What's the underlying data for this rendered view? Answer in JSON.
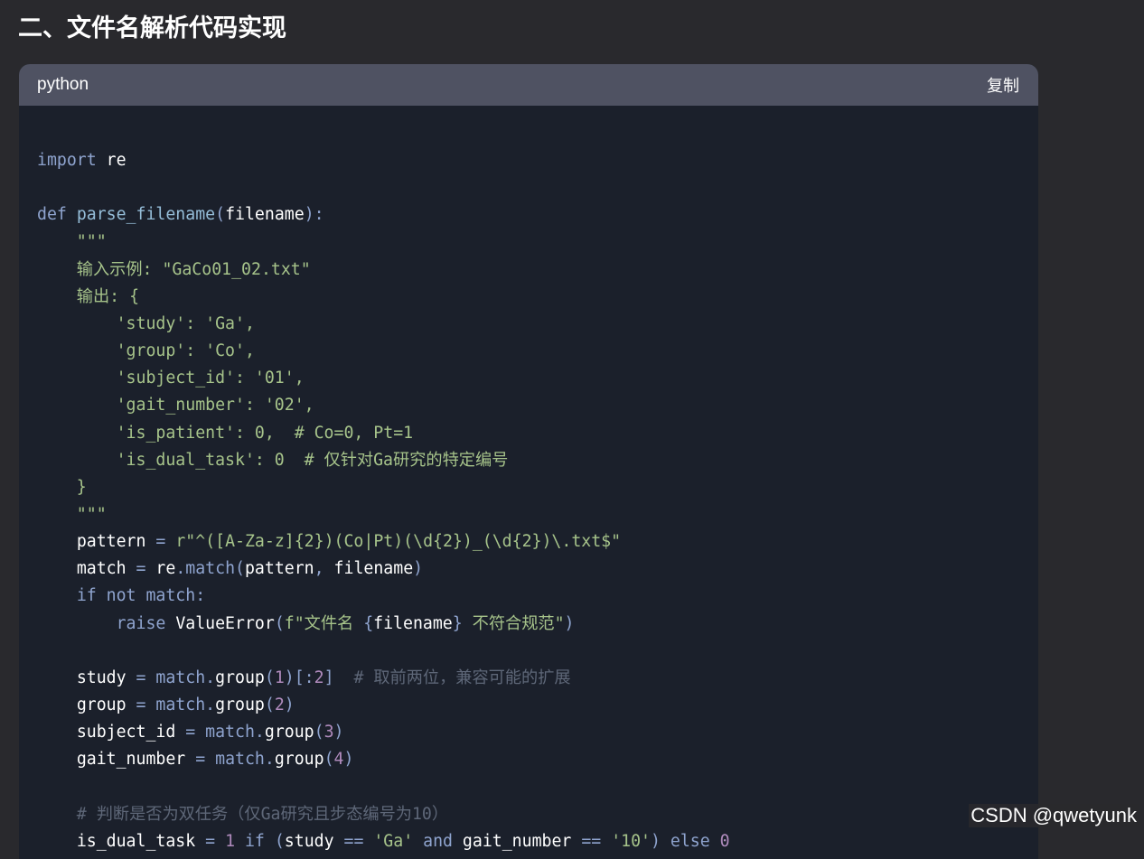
{
  "heading": "二、文件名解析代码实现",
  "code_block": {
    "language": "python",
    "copy_label": "复制",
    "lines": [
      [
        [
          "kw",
          "import"
        ],
        [
          "pl",
          " "
        ],
        [
          "id",
          "re"
        ]
      ],
      [],
      [
        [
          "kw",
          "def"
        ],
        [
          "pl",
          " "
        ],
        [
          "fn",
          "parse_filename"
        ],
        [
          "op",
          "("
        ],
        [
          "id",
          "filename"
        ],
        [
          "op",
          "):"
        ]
      ],
      [
        [
          "str",
          "    \"\"\""
        ]
      ],
      [
        [
          "str",
          "    输入示例: \"GaCo01_02.txt\""
        ]
      ],
      [
        [
          "str",
          "    输出: {"
        ]
      ],
      [
        [
          "str",
          "        'study': 'Ga',"
        ]
      ],
      [
        [
          "str",
          "        'group': 'Co',"
        ]
      ],
      [
        [
          "str",
          "        'subject_id': '01',"
        ]
      ],
      [
        [
          "str",
          "        'gait_number': '02',"
        ]
      ],
      [
        [
          "str",
          "        'is_patient': 0,  # Co=0, Pt=1"
        ]
      ],
      [
        [
          "str",
          "        'is_dual_task': 0  # 仅针对Ga研究的特定编号"
        ]
      ],
      [
        [
          "str",
          "    }"
        ]
      ],
      [
        [
          "str",
          "    \"\"\""
        ]
      ],
      [
        [
          "pl",
          "    "
        ],
        [
          "id",
          "pattern"
        ],
        [
          "op",
          " = "
        ],
        [
          "str",
          "r\"^([A-Za-z]{2})(Co|Pt)(\\d{2})_(\\d{2})\\.txt$\""
        ]
      ],
      [
        [
          "pl",
          "    "
        ],
        [
          "id",
          "match"
        ],
        [
          "op",
          " = "
        ],
        [
          "id",
          "re"
        ],
        [
          "op",
          ".match("
        ],
        [
          "id",
          "pattern"
        ],
        [
          "op",
          ", "
        ],
        [
          "id",
          "filename"
        ],
        [
          "op",
          ")"
        ]
      ],
      [
        [
          "pl",
          "    "
        ],
        [
          "kw",
          "if not match:"
        ]
      ],
      [
        [
          "pl",
          "        "
        ],
        [
          "kw",
          "raise"
        ],
        [
          "pl",
          " "
        ],
        [
          "id",
          "ValueError"
        ],
        [
          "op",
          "("
        ],
        [
          "str",
          "f\"文件名 "
        ],
        [
          "op",
          "{"
        ],
        [
          "id",
          "filename"
        ],
        [
          "op",
          "}"
        ],
        [
          "str",
          " 不符合规范\""
        ],
        [
          "op",
          ")"
        ]
      ],
      [],
      [
        [
          "pl",
          "    "
        ],
        [
          "id",
          "study"
        ],
        [
          "op",
          " = match."
        ],
        [
          "id",
          "group"
        ],
        [
          "op",
          "("
        ],
        [
          "num",
          "1"
        ],
        [
          "op",
          ")[:"
        ],
        [
          "num",
          "2"
        ],
        [
          "op",
          "]"
        ],
        [
          "cm",
          "  # 取前两位，兼容可能的扩展"
        ]
      ],
      [
        [
          "pl",
          "    "
        ],
        [
          "id",
          "group"
        ],
        [
          "op",
          " = match."
        ],
        [
          "id",
          "group"
        ],
        [
          "op",
          "("
        ],
        [
          "num",
          "2"
        ],
        [
          "op",
          ")"
        ]
      ],
      [
        [
          "pl",
          "    "
        ],
        [
          "id",
          "subject_id"
        ],
        [
          "op",
          " = match."
        ],
        [
          "id",
          "group"
        ],
        [
          "op",
          "("
        ],
        [
          "num",
          "3"
        ],
        [
          "op",
          ")"
        ]
      ],
      [
        [
          "pl",
          "    "
        ],
        [
          "id",
          "gait_number"
        ],
        [
          "op",
          " = match."
        ],
        [
          "id",
          "group"
        ],
        [
          "op",
          "("
        ],
        [
          "num",
          "4"
        ],
        [
          "op",
          ")"
        ]
      ],
      [],
      [
        [
          "cm",
          "    # 判断是否为双任务（仅Ga研究且步态编号为10）"
        ]
      ],
      [
        [
          "pl",
          "    "
        ],
        [
          "id",
          "is_dual_task"
        ],
        [
          "op",
          " = "
        ],
        [
          "num",
          "1"
        ],
        [
          "kw",
          " if "
        ],
        [
          "op",
          "("
        ],
        [
          "id",
          "study"
        ],
        [
          "op",
          " == "
        ],
        [
          "str",
          "'Ga'"
        ],
        [
          "kw",
          " and "
        ],
        [
          "id",
          "gait_number"
        ],
        [
          "op",
          " == "
        ],
        [
          "str",
          "'10'"
        ],
        [
          "op",
          ")"
        ],
        [
          "kw",
          " else "
        ],
        [
          "num",
          "0"
        ]
      ]
    ]
  },
  "watermark": "CSDN @qwetyunk",
  "colors": {
    "page_background": "#29292d",
    "code_background": "#1b202b",
    "header_background": "#4f5262",
    "keyword": "#8fa4cf",
    "string": "#a6c38a",
    "number": "#b08bbd",
    "comment": "#5e6778",
    "identifier": "#ffffff"
  }
}
